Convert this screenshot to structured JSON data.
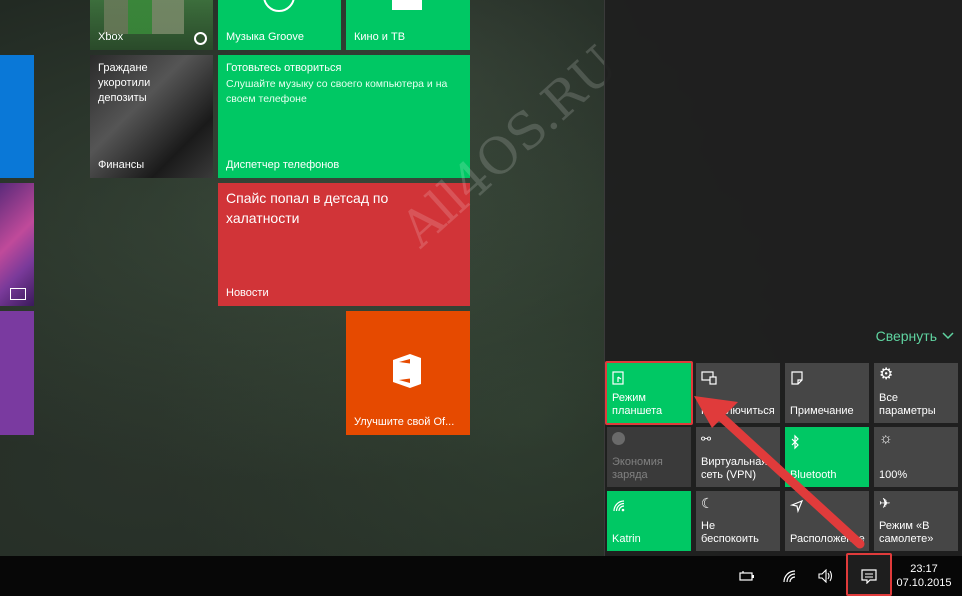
{
  "tiles": {
    "xbox": "Xbox",
    "groove": "Музыка Groove",
    "movies": "Кино и ТВ",
    "finance_headline": "Граждане укоротили депозиты",
    "finance": "Финансы",
    "phone_headline": "Готовьтесь отвориться",
    "phone_desc": "Слушайте музыку со своего компьютера и на своем телефоне",
    "phone": "Диспетчер телефонов",
    "news_headline": "Спайс попал в детсад по халатности",
    "news": "Новости",
    "office": "Улучшите свой Of..."
  },
  "watermark": "All4OS.RU",
  "action_center": {
    "collapse_label": "Свернуть",
    "quick_actions": [
      {
        "label": "Режим планшета",
        "icon": "tablet-mode-icon",
        "state": "on"
      },
      {
        "label": "Подключиться",
        "icon": "connect-icon",
        "state": "off"
      },
      {
        "label": "Примечание",
        "icon": "note-icon",
        "state": "off"
      },
      {
        "label": "Все параметры",
        "icon": "gear-icon",
        "state": "off"
      },
      {
        "label": "Экономия заряда",
        "icon": "battery-saver-icon",
        "state": "disabled"
      },
      {
        "label": "Виртуальная сеть (VPN)",
        "icon": "vpn-icon",
        "state": "off"
      },
      {
        "label": "Bluetooth",
        "icon": "bluetooth-icon",
        "state": "on"
      },
      {
        "label": "100%",
        "icon": "brightness-icon",
        "state": "off"
      },
      {
        "label": "Katrin",
        "icon": "wifi-icon",
        "state": "on"
      },
      {
        "label": "Не беспокоить",
        "icon": "moon-icon",
        "state": "off"
      },
      {
        "label": "Расположение",
        "icon": "location-icon",
        "state": "off"
      },
      {
        "label": "Режим «В самолете»",
        "icon": "airplane-icon",
        "state": "off"
      }
    ]
  },
  "taskbar": {
    "time": "23:17",
    "date": "07.10.2015"
  },
  "colors": {
    "accent_green": "#00c864",
    "news_red": "#d13438",
    "office_orange": "#e64a00",
    "highlight_red": "#e03b3b"
  }
}
